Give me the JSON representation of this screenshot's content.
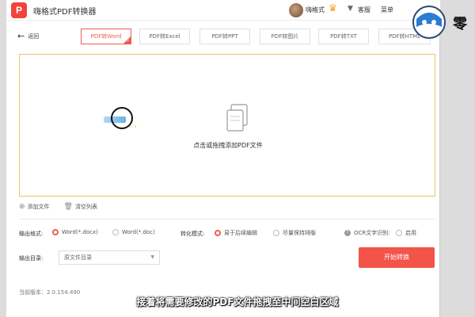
{
  "app": {
    "title": "嗨格式PDF转换器",
    "logo_letter": "P"
  },
  "header": {
    "username": "嗨格式",
    "crown_icon": "crown-icon",
    "links": [
      "客服",
      "菜单"
    ]
  },
  "nav": {
    "back_label": "返回"
  },
  "tabs": [
    {
      "label": "PDF转Word",
      "active": true
    },
    {
      "label": "PDF转Excel",
      "active": false
    },
    {
      "label": "PDF转PPT",
      "active": false
    },
    {
      "label": "PDF转图片",
      "active": false
    },
    {
      "label": "PDF转TXT",
      "active": false
    },
    {
      "label": "PDF转HTML",
      "active": false
    }
  ],
  "dropzone": {
    "hint": "点击或拖拽添加PDF文件",
    "icon": "document-stack-icon"
  },
  "file_actions": {
    "add": "添加文件",
    "clear": "清空列表"
  },
  "options": {
    "output_format_label": "输出格式:",
    "output_formats": [
      {
        "label": "Word(*.docx)",
        "selected": true
      },
      {
        "label": "Word(*.doc)",
        "selected": false
      }
    ],
    "convert_mode_label": "转化模式:",
    "convert_modes": [
      {
        "label": "易于后续编辑",
        "selected": true
      },
      {
        "label": "尽量保持排版",
        "selected": false
      }
    ],
    "ocr_label": "OCR文字识别:",
    "ocr_option": {
      "label": "启用",
      "selected": false
    }
  },
  "output_dir": {
    "label": "输出目录:",
    "value": "原文件目录"
  },
  "start_button": "开始转换",
  "version": "当前版本：2.0.154.490",
  "subtitle": "接着将需要修改的PDF文件拖拽至中间空白区域",
  "watermark": {
    "text": "零"
  },
  "colors": {
    "accent": "#f2544a",
    "dropzone_border": "#e9c56a"
  }
}
